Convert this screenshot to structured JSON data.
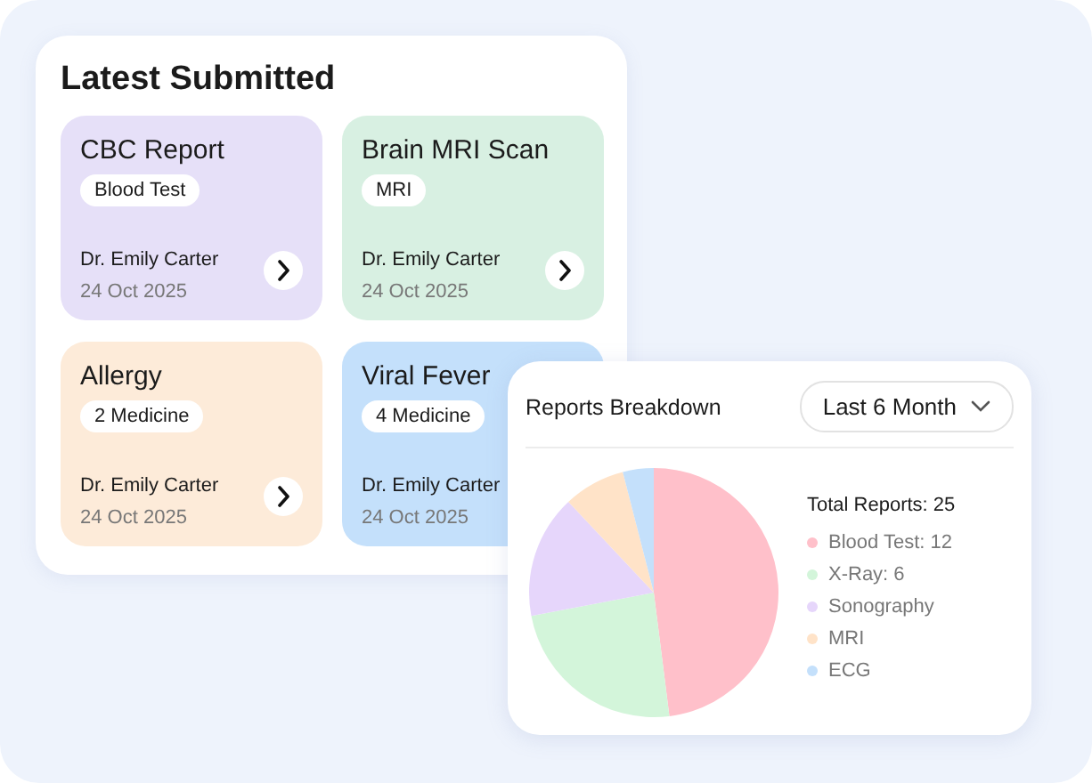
{
  "latest": {
    "title": "Latest Submitted",
    "cards": [
      {
        "title": "CBC Report",
        "tag": "Blood Test",
        "doctor": "Dr. Emily Carter",
        "date": "24 Oct 2025",
        "color": "#e6e0f8",
        "arrow": true
      },
      {
        "title": "Brain MRI Scan",
        "tag": "MRI",
        "doctor": "Dr. Emily Carter",
        "date": "24 Oct 2025",
        "color": "#d8f0e2",
        "arrow": true
      },
      {
        "title": "Allergy",
        "tag": "2 Medicine",
        "doctor": "Dr. Emily Carter",
        "date": "24 Oct 2025",
        "color": "#fdebd9",
        "arrow": true
      },
      {
        "title": "Viral Fever",
        "tag": "4 Medicine",
        "doctor": "Dr. Emily Carter",
        "date": "24 Oct 2025",
        "color": "#c4e0fb"
      }
    ]
  },
  "breakdown": {
    "title": "Reports Breakdown",
    "period": "Last 6 Month",
    "total": "Total Reports: 25",
    "legend": [
      {
        "label": "Blood Test: 12",
        "color": "#ffc0ca"
      },
      {
        "label": "X-Ray: 6",
        "color": "#d3f5da"
      },
      {
        "label": "Sonography",
        "color": "#e6d6fb"
      },
      {
        "label": "MRI",
        "color": "#ffe3c8"
      },
      {
        "label": "ECG",
        "color": "#c4e0fb"
      }
    ],
    "chart_data": {
      "type": "pie",
      "values": [
        48,
        24,
        16,
        8,
        4
      ]
    }
  }
}
